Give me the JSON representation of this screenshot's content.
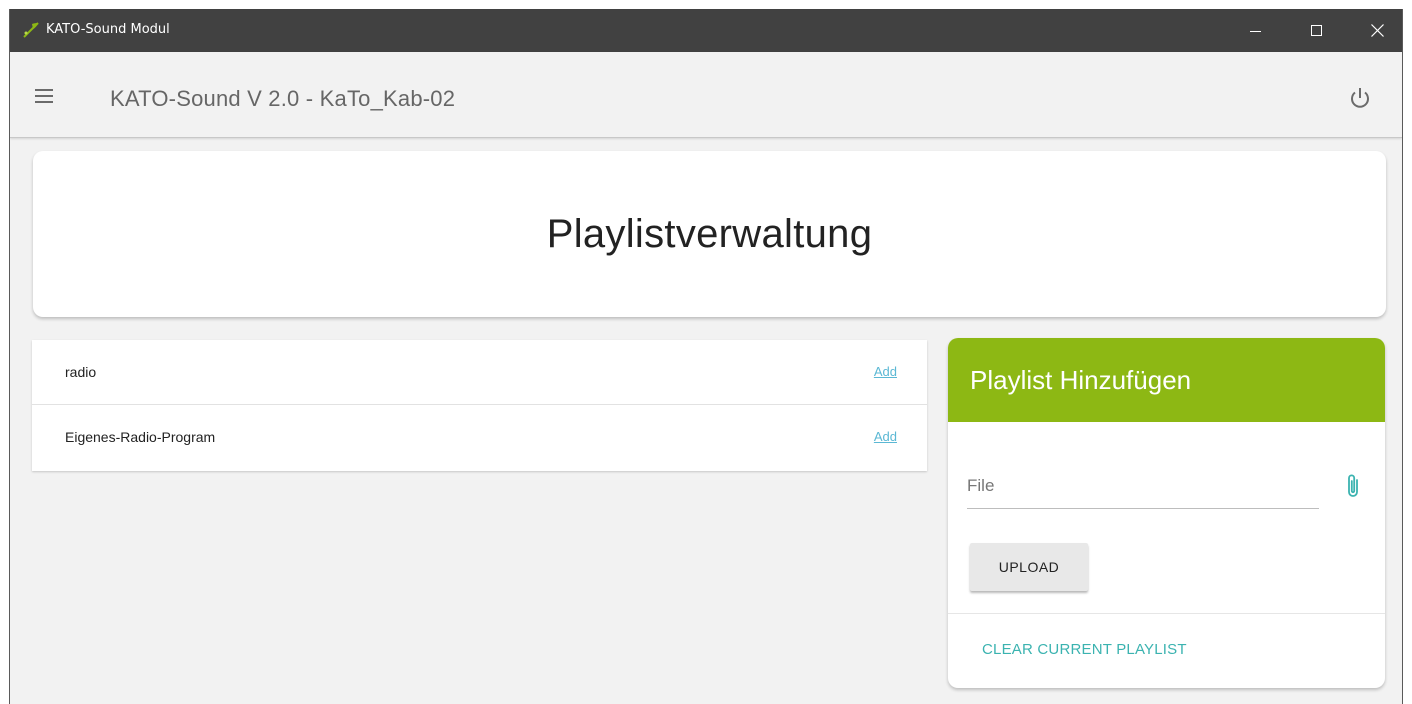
{
  "window": {
    "title": "KATO-Sound Modul",
    "icon": "kato-leaf-icon"
  },
  "appbar": {
    "title": "KATO-Sound V 2.0 - KaTo_Kab-02",
    "menu_icon": "hamburger-menu-icon",
    "power_icon": "power-icon"
  },
  "hero": {
    "title": "Playlistverwaltung"
  },
  "playlists": [
    {
      "name": "radio",
      "action": "Add"
    },
    {
      "name": "Eigenes-Radio-Program",
      "action": "Add"
    }
  ],
  "add_panel": {
    "title": "Playlist Hinzufügen",
    "file_placeholder": "File",
    "upload_label": "UPLOAD",
    "clear_label": "CLEAR CURRENT PLAYLIST",
    "attach_icon": "paperclip-icon"
  },
  "colors": {
    "titlebar": "#414141",
    "accent_green": "#8db814",
    "link_blue": "#5bb8d4",
    "teal": "#3bb3b0"
  }
}
